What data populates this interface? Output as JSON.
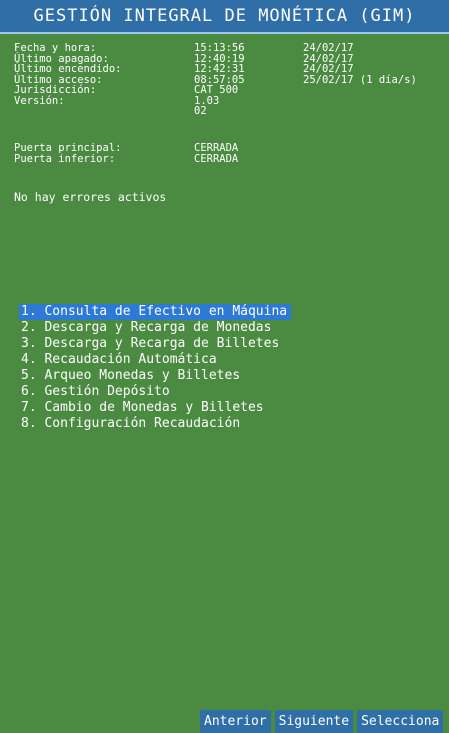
{
  "title": "GESTIÓN INTEGRAL DE MONÉTICA (GIM)",
  "info": {
    "fecha_label": "Fecha y hora:",
    "fecha_time": "15:13:56",
    "fecha_date": "24/02/17",
    "apagado_label": "Último apagado:",
    "apagado_time": "12:40:19",
    "apagado_date": "24/02/17",
    "encendido_label": "Último encendido:",
    "encendido_time": "12:42:31",
    "encendido_date": "24/02/17",
    "acceso_label": "Último acceso:",
    "acceso_time": "08:57:05",
    "acceso_date": "25/02/17 (1 día/s)",
    "jurisdiccion_label": "Jurisdicción:",
    "jurisdiccion_value": "CAT 500",
    "version_label": "Versión:",
    "version_value": "1.03",
    "version_sub": "02"
  },
  "doors": {
    "principal_label": "Puerta principal:",
    "principal_value": "CERRADA",
    "inferior_label": "Puerta inferior:",
    "inferior_value": "CERRADA"
  },
  "errors_text": "No hay errores activos",
  "menu": [
    "1. Consulta de Efectivo en Máquina",
    "2. Descarga y Recarga de Monedas",
    "3. Descarga y Recarga de Billetes",
    "4. Recaudación Automática",
    "5. Arqueo Monedas y Billetes",
    "6. Gestión Depósito",
    "7. Cambio de Monedas y Billetes",
    "8. Configuración Recaudación"
  ],
  "menu_selected_index": 0,
  "footer": {
    "anterior": "Anterior",
    "siguiente": "Siguiente",
    "selecciona": "Selecciona"
  },
  "colors": {
    "background": "#4a8a41",
    "title_bar": "#2f6ea6",
    "selection": "#2d79d6"
  }
}
